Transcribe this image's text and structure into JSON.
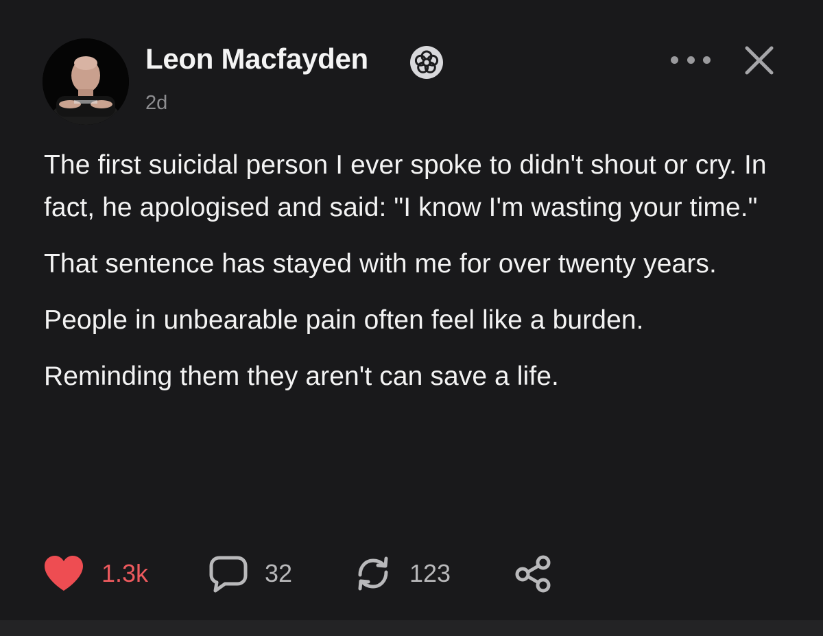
{
  "author": {
    "name": "Leon Macfayden",
    "verified_icon": "verified-flower-badge-icon",
    "timestamp": "2d"
  },
  "header_actions": {
    "more_icon": "more-horizontal-icon",
    "close_icon": "close-icon"
  },
  "post": {
    "paragraphs": [
      "The first suicidal person I ever spoke to didn't shout or cry. In fact, he apologised and said: \"I know I'm wasting your time.\"",
      "That sentence has stayed with me for over twenty years.",
      "People in unbearable pain often feel like a burden.",
      "Reminding them they aren't can save a life."
    ]
  },
  "actions": {
    "like": {
      "icon": "heart-icon",
      "count": "1.3k",
      "liked": true
    },
    "reply": {
      "icon": "comment-icon",
      "count": "32"
    },
    "repost": {
      "icon": "repost-icon",
      "count": "123"
    },
    "share": {
      "icon": "share-icon"
    }
  },
  "colors": {
    "background": "#19191b",
    "text": "#f3f3f3",
    "muted": "#8d8d90",
    "like_red": "#ee5a5e"
  }
}
